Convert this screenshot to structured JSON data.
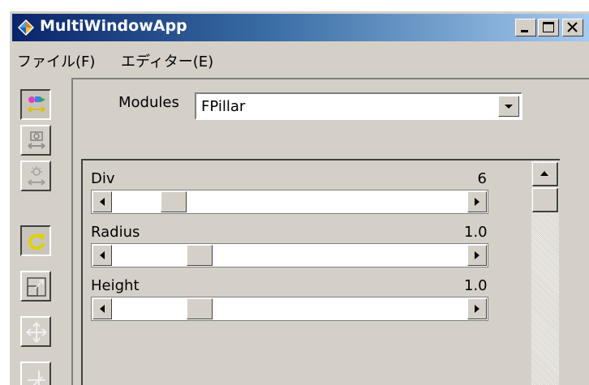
{
  "window": {
    "title": "MultiWindowApp"
  },
  "menu": [
    "ファイル(F)",
    "エディター(E)"
  ],
  "toolbar": {
    "buttons": [
      {
        "icon": "shapes-move-icon",
        "pressed": true
      },
      {
        "icon": "camera-move-icon",
        "pressed": false
      },
      {
        "icon": "light-move-icon",
        "pressed": false
      },
      {
        "icon": "rotate-icon",
        "pressed": true
      },
      {
        "icon": "scale-icon",
        "pressed": false
      },
      {
        "icon": "move-arrows-icon",
        "pressed": false
      },
      {
        "icon": "axis-icon",
        "pressed": false
      }
    ]
  },
  "modules": {
    "label": "Modules",
    "selected": "FPillar"
  },
  "params": [
    {
      "label": "Div",
      "value": "6",
      "level": 0.14
    },
    {
      "label": "Radius",
      "value": "1.0",
      "level": 0.22
    },
    {
      "label": "Height",
      "value": "1.0",
      "level": 0.22
    }
  ]
}
